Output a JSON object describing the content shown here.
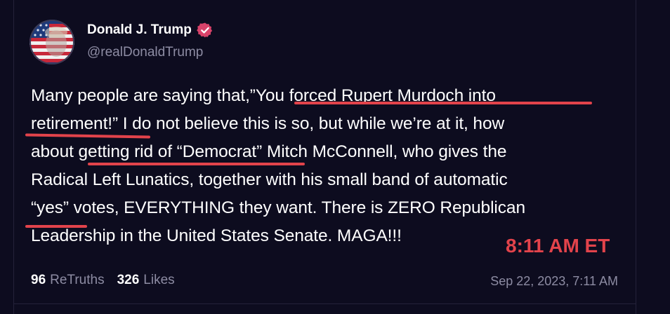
{
  "author": {
    "display_name": "Donald J. Trump",
    "handle": "@realDonaldTrump"
  },
  "post": {
    "lines": [
      [
        "Many people are saying that,”",
        "You forced Rupert Murdoch into"
      ],
      [
        "retirement!”",
        " I do not believe this is so, but while we’re at it, how"
      ],
      [
        "about ",
        "getting rid of “Democrat”",
        " Mitch McConnell, who gives the"
      ],
      [
        "Radical Left Lunatics, together with his small band of automatic"
      ],
      [
        "“yes”",
        " votes, EVERYTHING they want. There is ZERO Republican"
      ],
      [
        "Leadership in the United States Senate. MAGA!!!"
      ]
    ]
  },
  "overlay_time": "8:11 AM ET",
  "stats": {
    "retruths_count": "96",
    "retruths_label": "ReTruths",
    "likes_count": "326",
    "likes_label": "Likes"
  },
  "post_date": "Sep 22, 2023, 7:11 AM",
  "colors": {
    "background": "#0d0c1f",
    "accent": "#e2434b",
    "muted": "#8d8ca3",
    "verified": "#d8436a"
  },
  "icons": {
    "verified": "verified-badge-icon",
    "avatar": "profile-avatar"
  }
}
